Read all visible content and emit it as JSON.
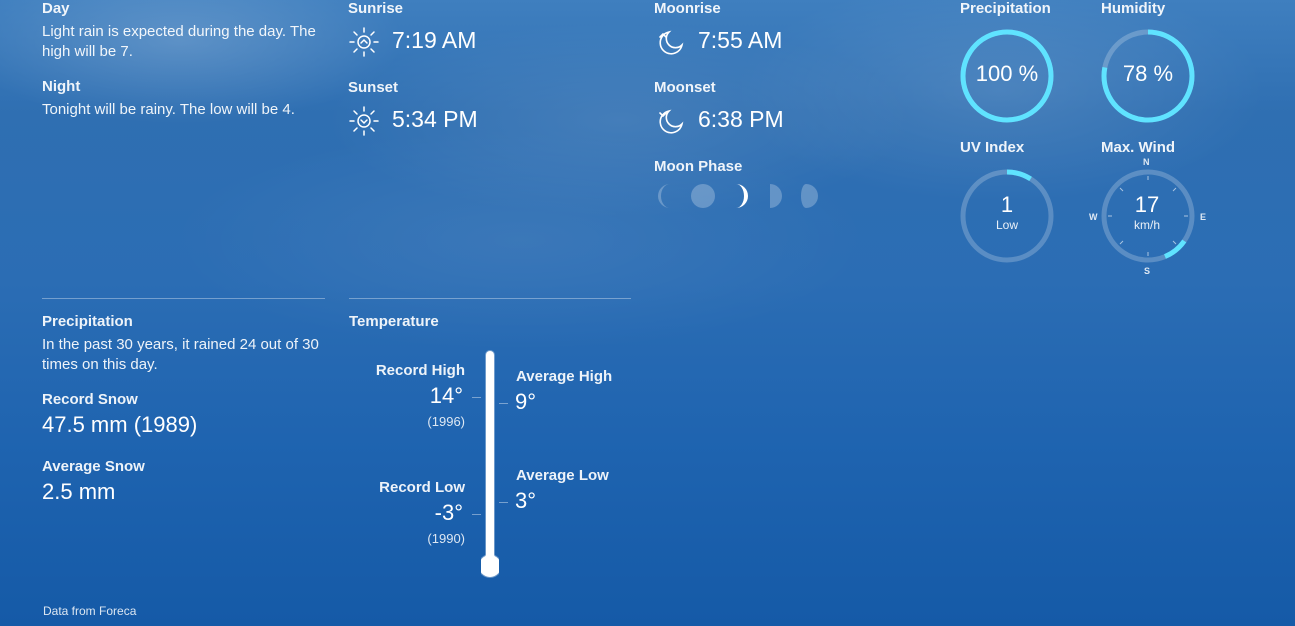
{
  "forecast": {
    "day_label": "Day",
    "day_text": "Light rain is expected during the day. The high will be 7.",
    "night_label": "Night",
    "night_text": "Tonight will be rainy. The low will be 4."
  },
  "sun": {
    "sunrise_label": "Sunrise",
    "sunrise_time": "7:19 AM",
    "sunset_label": "Sunset",
    "sunset_time": "5:34 PM",
    "sunrise_icon": "sunrise-icon",
    "sunset_icon": "sunset-icon"
  },
  "moon": {
    "moonrise_label": "Moonrise",
    "moonrise_time": "7:55 AM",
    "moonset_label": "Moonset",
    "moonset_time": "6:38 PM",
    "phase_label": "Moon Phase",
    "icon": "moon-icon"
  },
  "gauges": {
    "precip_label": "Precipitation",
    "precip_value": "100 %",
    "precip_fraction": 1.0,
    "humidity_label": "Humidity",
    "humidity_value": "78 %",
    "humidity_fraction": 0.78,
    "uv_label": "UV Index",
    "uv_value": "1",
    "uv_desc": "Low",
    "uv_fraction": 0.09,
    "wind_label": "Max. Wind",
    "wind_value": "17",
    "wind_unit": "km/h",
    "compass_n": "N",
    "compass_e": "E",
    "compass_s": "S",
    "compass_w": "W",
    "accent_color": "#5fe3ff"
  },
  "history_precip": {
    "precip_label": "Precipitation",
    "precip_text": "In the past 30 years, it rained 24 out of 30 times on this day.",
    "record_snow_label": "Record Snow",
    "record_snow_value": "47.5 mm (1989)",
    "avg_snow_label": "Average Snow",
    "avg_snow_value": "2.5 mm"
  },
  "history_temp": {
    "title": "Temperature",
    "record_high_label": "Record High",
    "record_high_value": "14°",
    "record_high_year": "(1996)",
    "record_low_label": "Record Low",
    "record_low_value": "-3°",
    "record_low_year": "(1990)",
    "avg_high_label": "Average High",
    "avg_high_value": "9°",
    "avg_low_label": "Average Low",
    "avg_low_value": "3°"
  },
  "footer": {
    "source": "Data from Foreca"
  }
}
